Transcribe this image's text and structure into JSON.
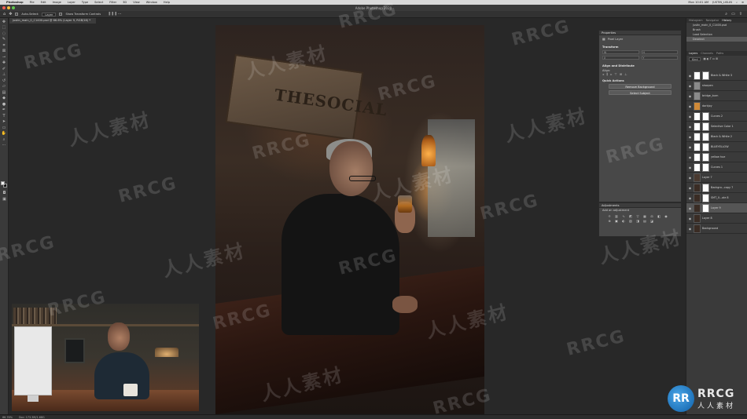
{
  "menubar": {
    "items": [
      "Photoshop",
      "File",
      "Edit",
      "Image",
      "Layer",
      "Type",
      "Select",
      "Filter",
      "3D",
      "View",
      "Window",
      "Help"
    ],
    "clock": "Mon 10:01 AM",
    "user": "JUSTIN_LISLIN"
  },
  "window": {
    "title": "Adobe Photoshop 2020"
  },
  "options": {
    "auto_select_label": "Auto-Select:",
    "auto_select_value": "Layer",
    "show_transform_label": "Show Transform Controls"
  },
  "document": {
    "tab": "justin_main_0_C1400.psd @ 66.6% (Layer 9, RGB/16) *"
  },
  "artwork": {
    "sign_text": "THESOCIAL"
  },
  "properties": {
    "tab_label": "Properties",
    "layer_kind": "Pixel Layer",
    "transform_label": "Transform",
    "transform_fields": [
      "W",
      "H",
      "X",
      "Y"
    ],
    "align_label": "Align and Distribute",
    "align_sub": "Align:",
    "quick_actions_label": "Quick Actions",
    "remove_bg_button": "Remove Background",
    "select_subject_button": "Select Subject"
  },
  "adjustments": {
    "tab_label": "Adjustments",
    "subtitle": "Add an adjustment"
  },
  "history": {
    "tabs": [
      "Histogram",
      "Navigator",
      "History"
    ],
    "source": "justin_main_0_C1400.psd",
    "items": [
      "Brush",
      "Load Selection",
      "Deselect"
    ]
  },
  "layers": {
    "tabs": [
      "Layers",
      "Channels",
      "Paths"
    ],
    "kind_filter": "Kind",
    "items": [
      {
        "name": "Black & White 3",
        "thumb": "#ffffff",
        "mask": true
      },
      {
        "name": "sharpen",
        "thumb": "#8a8a8a",
        "mask": false
      },
      {
        "name": "bridge_burn",
        "thumb": "#8a8a8a",
        "mask": false
      },
      {
        "name": "darkjoy",
        "thumb": "#d08a38",
        "mask": false
      },
      {
        "name": "Curves 2",
        "thumb": "#ffffff",
        "mask": true
      },
      {
        "name": "Selective Color 1",
        "thumb": "#ffffff",
        "mask": true
      },
      {
        "name": "Black & White 2",
        "thumb": "#ffffff",
        "mask": true
      },
      {
        "name": "BLUEYELLOW",
        "thumb": "#ffffff",
        "mask": true
      },
      {
        "name": "yellow hue",
        "thumb": "#ffffff",
        "mask": true
      },
      {
        "name": "Curves 1",
        "thumb": "#ffffff",
        "mask": true
      },
      {
        "name": "Layer 7",
        "thumb": "#4a3a30",
        "mask": false
      },
      {
        "name": "Backgro...copy 7",
        "thumb": "#3a2c24",
        "mask": true
      },
      {
        "name": "SMT_0...ale 8",
        "thumb": "#3a2c24",
        "mask": true
      },
      {
        "name": "Layer 9",
        "thumb": "#3a2c24",
        "mask": true
      },
      {
        "name": "Layer 8",
        "thumb": "#3a2c24",
        "mask": false
      },
      {
        "name": "Background",
        "thumb": "#3a2c24",
        "mask": false
      }
    ],
    "selected_index": 13
  },
  "status": {
    "zoom": "66.76%",
    "doc": "Doc: 173.3M/1.68G"
  },
  "watermarks": {
    "en": "RRCG",
    "cn": "人人素材"
  },
  "logo": {
    "mark": "RR",
    "text1": "RRCG",
    "text2": "人人素材"
  }
}
